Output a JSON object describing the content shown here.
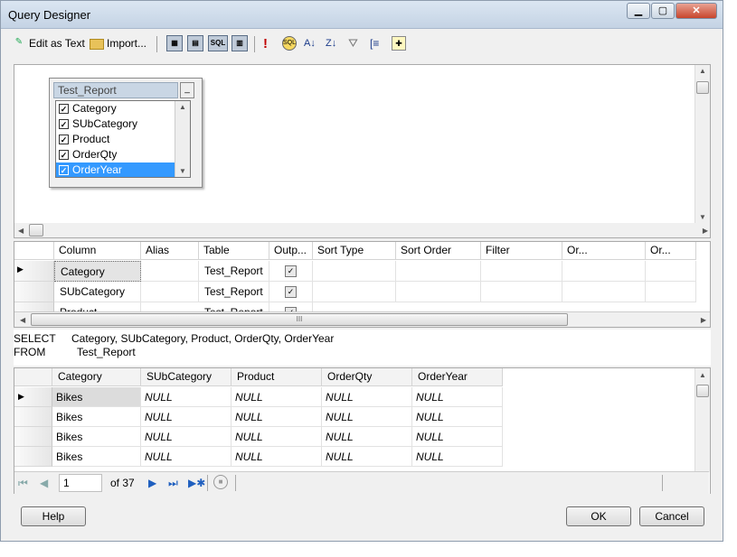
{
  "window": {
    "title": "Query Designer",
    "controls": {
      "minimize": "▁",
      "maximize": "▢",
      "close": "✕"
    }
  },
  "toolbar": {
    "edit_as_text": "Edit as Text",
    "import": "Import...",
    "icons": [
      "diagram-pane-icon",
      "grid-pane-icon",
      "sql-pane-icon",
      "result-pane-icon",
      "run-icon",
      "verify-sql-icon",
      "sort-ascending-icon",
      "sort-descending-icon",
      "remove-filter-icon",
      "group-by-icon",
      "add-table-icon"
    ],
    "sql_badge": "SQL"
  },
  "diagram": {
    "table_name": "Test_Report",
    "minimize": "_",
    "columns": [
      {
        "name": "Category",
        "checked": true
      },
      {
        "name": "SUbCategory",
        "checked": true
      },
      {
        "name": "Product",
        "checked": true
      },
      {
        "name": "OrderQty",
        "checked": true
      },
      {
        "name": "OrderYear",
        "checked": true,
        "selected": true
      }
    ]
  },
  "criteria_grid": {
    "headers": [
      "Column",
      "Alias",
      "Table",
      "Outp...",
      "Sort Type",
      "Sort Order",
      "Filter",
      "Or...",
      "Or..."
    ],
    "rows": [
      {
        "column": "Category",
        "alias": "",
        "table": "Test_Report",
        "output": true
      },
      {
        "column": "SUbCategory",
        "alias": "",
        "table": "Test_Report",
        "output": true
      },
      {
        "column": "Product",
        "alias": "",
        "table": "Test_Report",
        "output": true
      }
    ],
    "scroll_grip": "III"
  },
  "sql": {
    "select_kw": "SELECT",
    "select_list": "Category, SUbCategory, Product, OrderQty, OrderYear",
    "from_kw": "FROM",
    "from_table": "Test_Report"
  },
  "results": {
    "headers": [
      "Category",
      "SUbCategory",
      "Product",
      "OrderQty",
      "OrderYear"
    ],
    "rows": [
      [
        "Bikes",
        "NULL",
        "NULL",
        "NULL",
        "NULL"
      ],
      [
        "Bikes",
        "NULL",
        "NULL",
        "NULL",
        "NULL"
      ],
      [
        "Bikes",
        "NULL",
        "NULL",
        "NULL",
        "NULL"
      ],
      [
        "Bikes",
        "NULL",
        "NULL",
        "NULL",
        "NULL"
      ]
    ]
  },
  "navigator": {
    "current_page": "1",
    "of_total": "of 37"
  },
  "buttons": {
    "help": "Help",
    "ok": "OK",
    "cancel": "Cancel"
  },
  "colors": {
    "selection": "#3399ff",
    "titlebar": "#c4d3e4",
    "run_icon": "#c00000"
  }
}
